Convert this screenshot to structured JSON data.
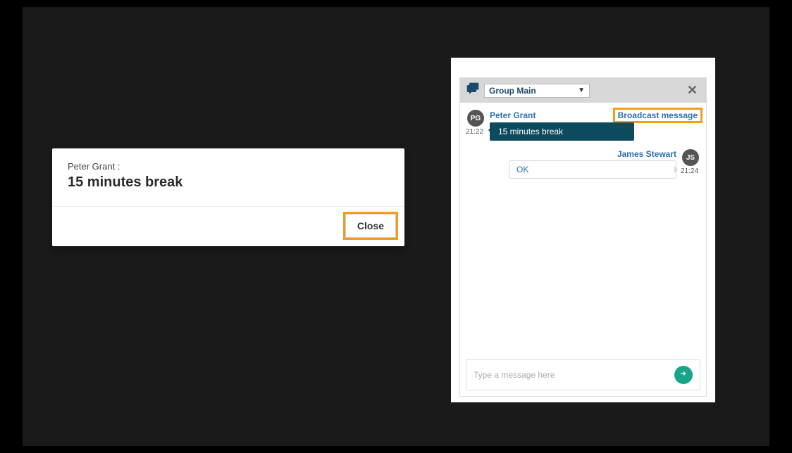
{
  "dialog": {
    "sender_label": "Peter Grant :",
    "message_text": "15 minutes break",
    "close_label": "Close"
  },
  "chat": {
    "group_label": "Group Main",
    "close_glyph": "✕",
    "input_placeholder": "Type a message here",
    "messages": {
      "m1": {
        "initials": "PG",
        "sender": "Peter Grant",
        "tag": "Broadcast message",
        "text": "15 minutes break",
        "time": "21:22"
      },
      "m2": {
        "initials": "JS",
        "sender": "James Stewart",
        "text": "OK",
        "time": "21:24"
      }
    }
  }
}
